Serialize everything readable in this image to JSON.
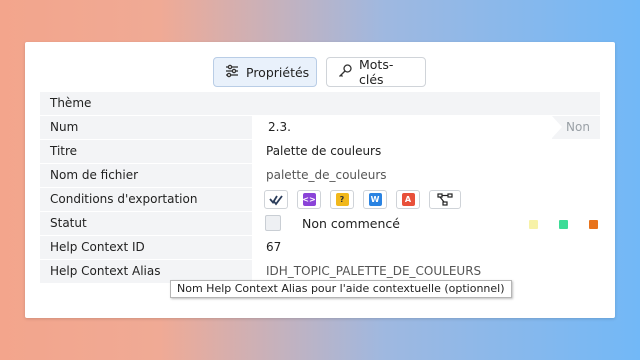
{
  "tabs": {
    "properties_label": "Propriétés",
    "keywords_label": "Mots-clés"
  },
  "properties": {
    "theme_label": "Thème",
    "num_label": "Num",
    "num_value": "2.3.",
    "num_suffix": "Non",
    "title_label": "Titre",
    "title_value": "Palette de couleurs",
    "filename_label": "Nom de fichier",
    "filename_value": "palette_de_couleurs",
    "export_label": "Conditions d'exportation",
    "export_icons": [
      "checkmark-icon",
      "code-icon",
      "help-icon",
      "word-icon",
      "pdf-icon",
      "workflow-icon"
    ],
    "status_label": "Statut",
    "status_value": "Non commencé",
    "status_colors": [
      "#f5f0a0",
      "#3ddc97",
      "#e8731c"
    ],
    "help_id_label": "Help Context ID",
    "help_id_value": "67",
    "help_alias_label": "Help Context Alias",
    "help_alias_value": "IDH_TOPIC_PALETTE_DE_COULEURS"
  },
  "tooltip": {
    "text": "Nom Help Context Alias pour l'aide contextuelle (optionnel)"
  }
}
